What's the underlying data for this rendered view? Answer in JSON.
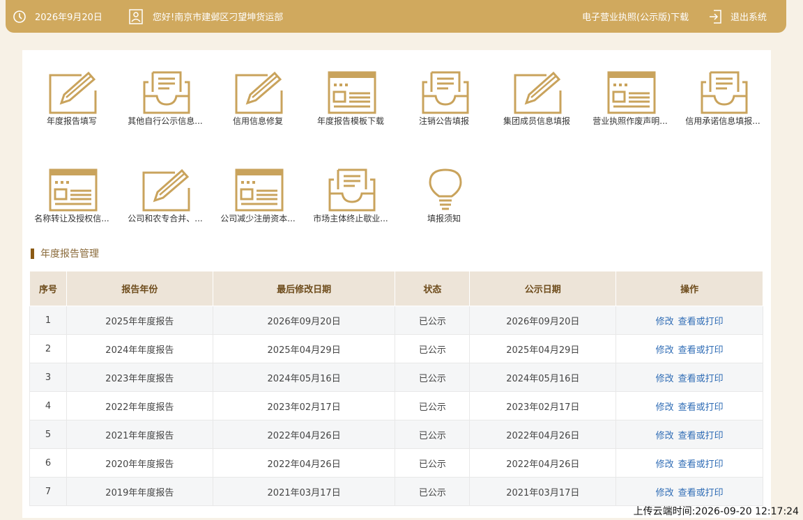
{
  "header": {
    "date": "2026年9月20日",
    "greeting": "您好!南京市建邺区刁望坤货运部",
    "license_download": "电子营业执照(公示版)下载",
    "logout": "退出系统"
  },
  "colors": {
    "accent": "#d0a95e",
    "icon": "#c9a35c",
    "link": "#2f6cb5",
    "section_bar": "#8b5a14"
  },
  "tiles": [
    {
      "label": "年度报告填写",
      "icon": "edit-icon"
    },
    {
      "label": "其他自行公示信息...",
      "icon": "inbox-doc-icon"
    },
    {
      "label": "信用信息修复",
      "icon": "edit-icon"
    },
    {
      "label": "年度报告模板下载",
      "icon": "template-window-icon"
    },
    {
      "label": "注销公告填报",
      "icon": "inbox-doc-icon"
    },
    {
      "label": "集团成员信息填报",
      "icon": "edit-icon"
    },
    {
      "label": "营业执照作废声明...",
      "icon": "template-window-icon"
    },
    {
      "label": "信用承诺信息填报...",
      "icon": "inbox-doc-icon"
    },
    {
      "label": "名称转让及授权信...",
      "icon": "template-window-icon"
    },
    {
      "label": "公司和农专合并、...",
      "icon": "edit-icon"
    },
    {
      "label": "公司减少注册资本...",
      "icon": "template-window-icon"
    },
    {
      "label": "市场主体终止歇业...",
      "icon": "inbox-doc-icon"
    },
    {
      "label": "填报须知",
      "icon": "lightbulb-icon"
    }
  ],
  "section": {
    "title": "年度报告管理"
  },
  "table": {
    "headers": [
      "序号",
      "报告年份",
      "最后修改日期",
      "状态",
      "公示日期",
      "操作"
    ],
    "edit_label": "修改",
    "view_label": "查看或打印",
    "rows": [
      [
        "1",
        "2025年年度报告",
        "2026年09月20日",
        "已公示",
        "2026年09月20日"
      ],
      [
        "2",
        "2024年年度报告",
        "2025年04月29日",
        "已公示",
        "2025年04月29日"
      ],
      [
        "3",
        "2023年年度报告",
        "2024年05月16日",
        "已公示",
        "2024年05月16日"
      ],
      [
        "4",
        "2022年年度报告",
        "2023年02月17日",
        "已公示",
        "2023年02月17日"
      ],
      [
        "5",
        "2021年年度报告",
        "2022年04月26日",
        "已公示",
        "2022年04月26日"
      ],
      [
        "6",
        "2020年年度报告",
        "2022年04月26日",
        "已公示",
        "2022年04月26日"
      ],
      [
        "7",
        "2019年年度报告",
        "2021年03月17日",
        "已公示",
        "2021年03月17日"
      ]
    ]
  },
  "footer": {
    "upload_time": "上传云端时间:2026-09-20 12:17:24"
  }
}
